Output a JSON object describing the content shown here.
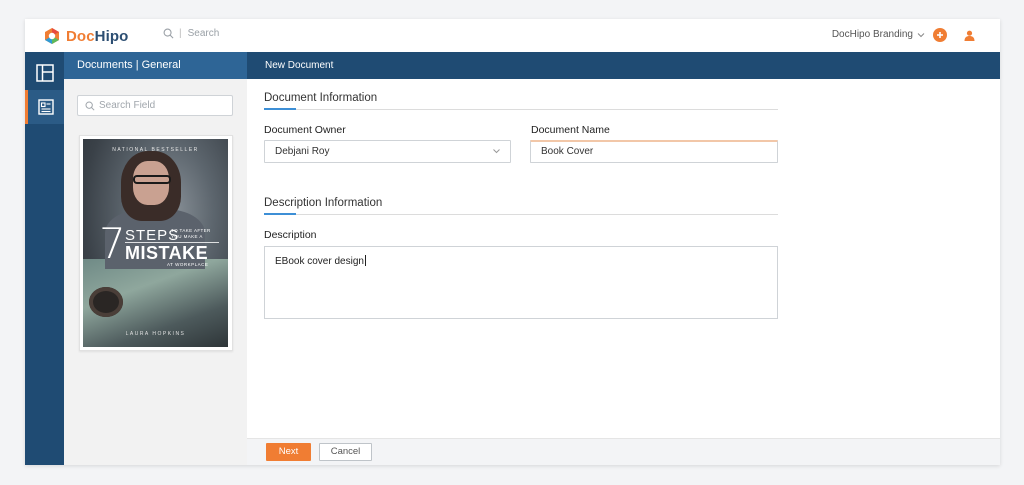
{
  "app": {
    "logo_text_doc": "Doc",
    "logo_text_hipo": "Hipo",
    "search_placeholder": "Search",
    "brand_menu_label": "DocHipo Branding",
    "accent_color": "#f07d33",
    "primary_color": "#1f4b73"
  },
  "rail": {
    "items": [
      {
        "icon": "layout-icon",
        "active": false
      },
      {
        "icon": "document-form-icon",
        "active": true
      }
    ]
  },
  "panel": {
    "header": "Documents | General",
    "search_placeholder": "Search Field",
    "thumbnail": {
      "top_text": "NATIONAL BESTSELLER",
      "number": "7",
      "steps": "STEPS",
      "small_text": "TO TAKE AFTER YOU MAKE A",
      "mistake": "MISTAKE",
      "workplace": "AT WORKPLACE",
      "author": "LAURA HOPKINS"
    }
  },
  "main": {
    "header": "New Document",
    "doc_info_title": "Document Information",
    "owner_label": "Document Owner",
    "owner_value": "Debjani Roy",
    "name_label": "Document Name",
    "name_value": "Book Cover",
    "desc_info_title": "Description Information",
    "description_label": "Description",
    "description_value": "EBook cover design"
  },
  "footer": {
    "next_label": "Next",
    "cancel_label": "Cancel"
  }
}
